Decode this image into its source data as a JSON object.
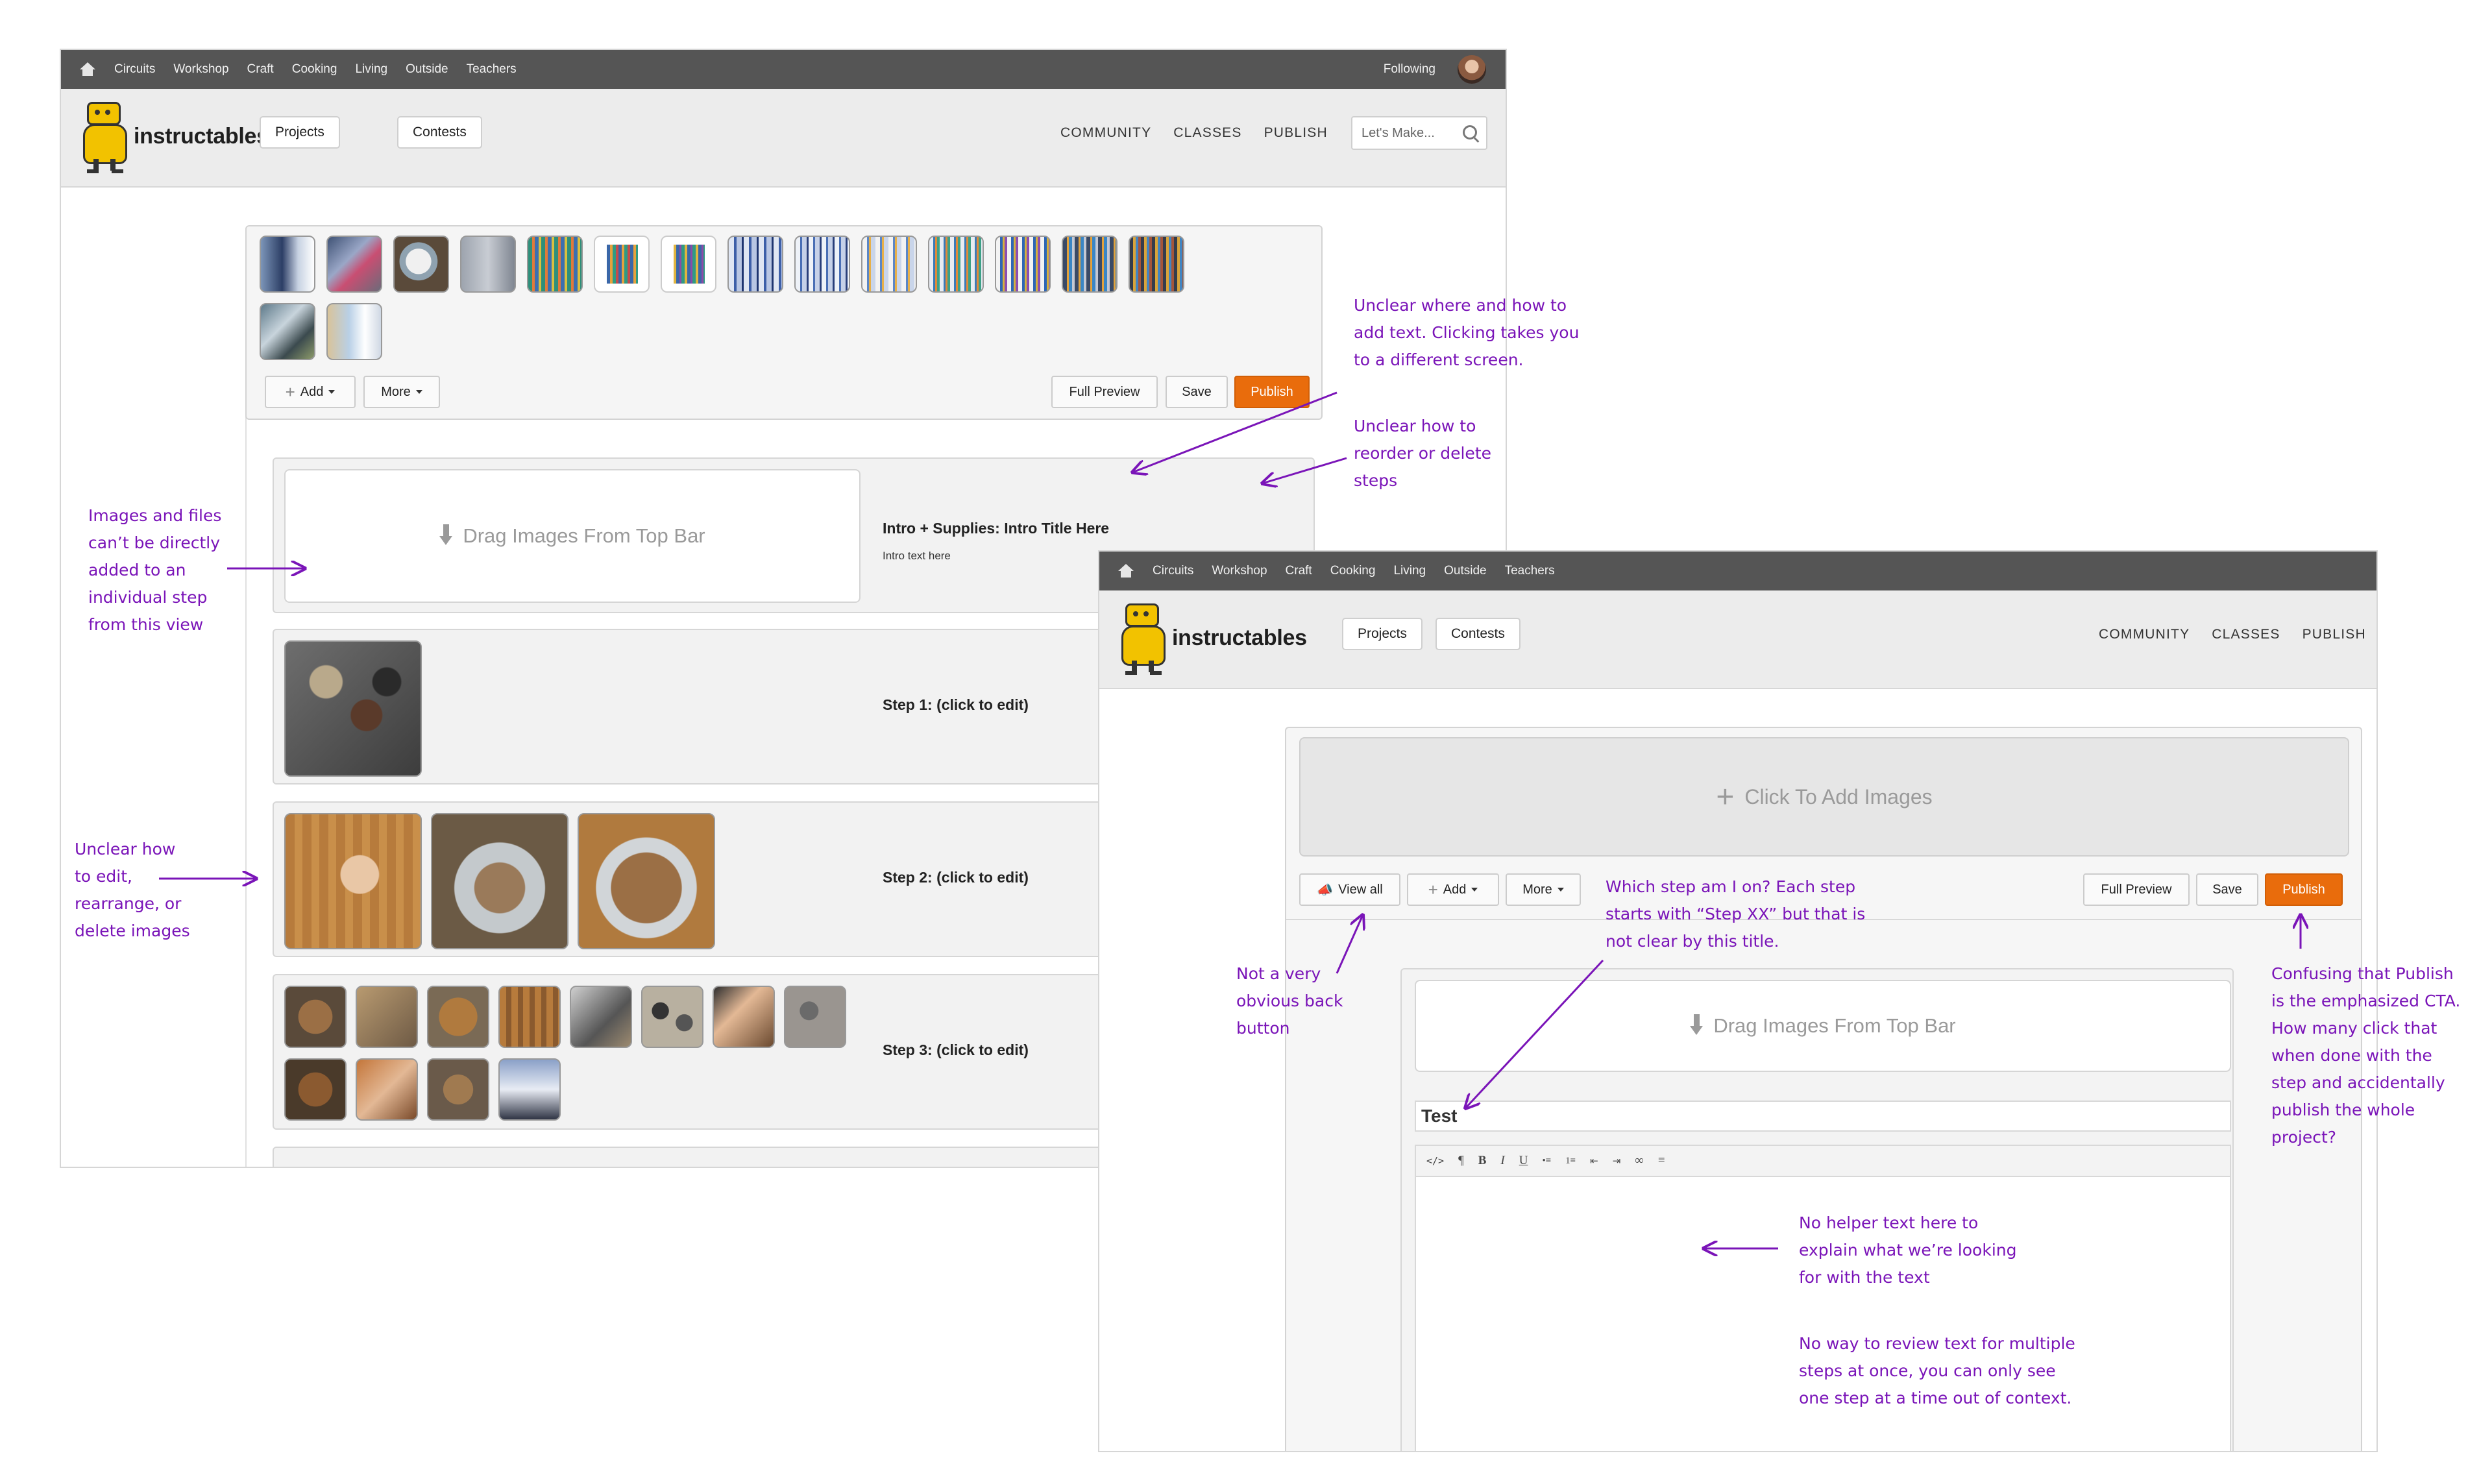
{
  "top_nav": [
    "Circuits",
    "Workshop",
    "Craft",
    "Cooking",
    "Living",
    "Outside",
    "Teachers"
  ],
  "following_label": "Following",
  "logo_text": "instructables",
  "header_buttons": {
    "projects": "Projects",
    "contests": "Contests"
  },
  "header_nav": [
    "COMMUNITY",
    "CLASSES",
    "PUBLISH"
  ],
  "search_placeholder": "Let's Make...",
  "toolbar": {
    "add": "Add",
    "more": "More",
    "full_preview": "Full Preview",
    "save": "Save",
    "publish": "Publish",
    "view_all": "View all"
  },
  "accent_color": "#e96c0c",
  "annotation_color": "#7a14b8",
  "editor1": {
    "drop_text": "Drag Images From Top Bar",
    "intro_title": "Intro + Supplies: Intro Title Here",
    "intro_text": "Intro text here",
    "steps": [
      "Step 1: (click to edit)",
      "Step 2: (click to edit)",
      "Step 3: (click to edit)"
    ]
  },
  "editor2": {
    "add_images": "Click To Add Images",
    "drop_text": "Drag Images From Top Bar",
    "title_value": "Test",
    "rte_buttons": [
      "</>",
      "¶",
      "B",
      "I",
      "U",
      "•≡",
      "1≡",
      "⇤",
      "⇥",
      "∞",
      "≡"
    ]
  },
  "annotations": {
    "a1": [
      "Unclear where and how to",
      "add text. Clicking takes you",
      "to a different screen."
    ],
    "a2": [
      "Unclear how to",
      "reorder or delete",
      "steps"
    ],
    "a3": [
      "Images and files",
      "can’t be directly",
      "added to an",
      "individual step",
      "from this view"
    ],
    "a4": [
      "Unclear how",
      "to edit,",
      "rearrange, or",
      "delete images"
    ],
    "a5": [
      "Which step am I on? Each step",
      "starts with “Step XX” but that is",
      "not clear by this title."
    ],
    "a6": [
      "Not a very",
      "obvious back",
      "button"
    ],
    "a7": [
      "Confusing that Publish",
      "is the emphasized CTA.",
      "How many click that",
      "when done with the",
      "step and accidentally",
      "publish the whole",
      "project?"
    ],
    "a8": [
      "No helper text here to",
      "explain what we’re looking",
      "for with the text"
    ],
    "a9": [
      "No way to review text for multiple",
      "steps at once, you can only see",
      "one step at a time out of context."
    ]
  }
}
